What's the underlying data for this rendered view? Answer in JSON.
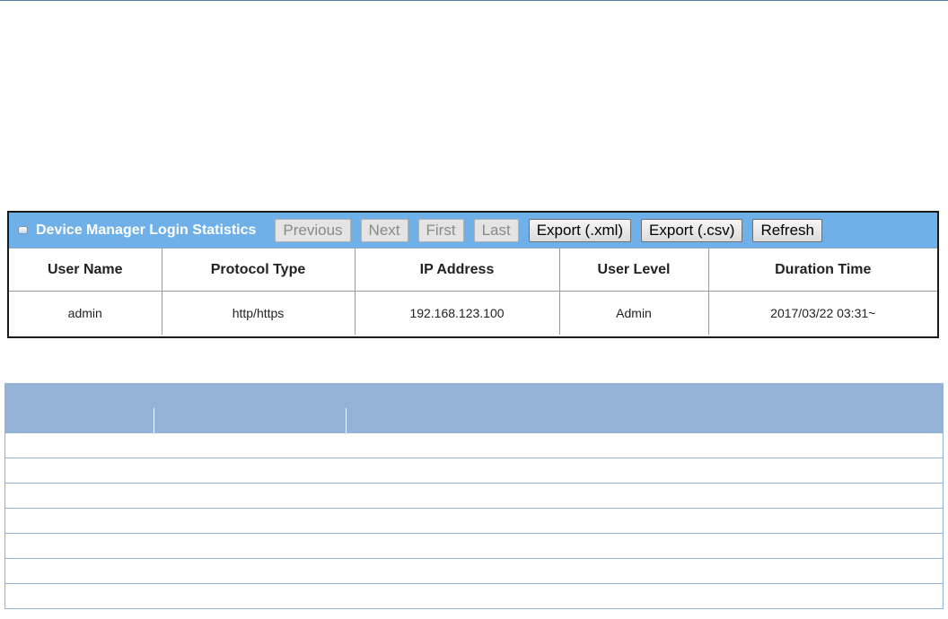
{
  "panel": {
    "title": "Device Manager Login Statistics",
    "buttons": {
      "previous": "Previous",
      "next": "Next",
      "first": "First",
      "last": "Last",
      "export_xml": "Export (.xml)",
      "export_csv": "Export (.csv)",
      "refresh": "Refresh"
    },
    "columns": [
      "User Name",
      "Protocol Type",
      "IP Address",
      "User Level",
      "Duration Time"
    ],
    "rows": [
      [
        "admin",
        "http/https",
        "192.168.123.100",
        "Admin",
        "2017/03/22 03:31~"
      ]
    ]
  },
  "colors": {
    "panel_header": "#6fb0e8",
    "desc_header": "#95b3d7",
    "desc_border": "#95b3d7"
  }
}
